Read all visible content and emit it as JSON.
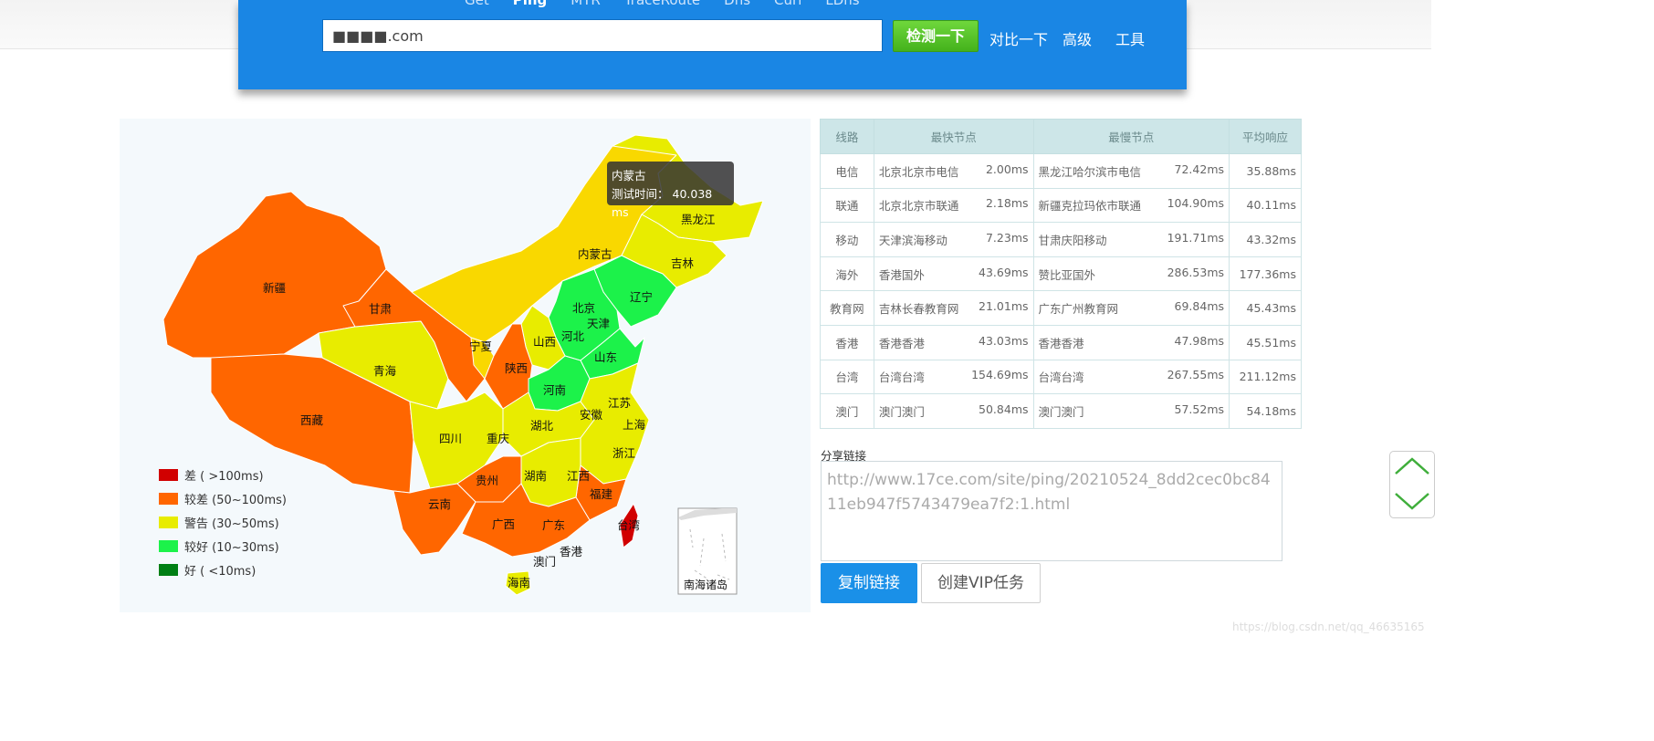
{
  "header": {
    "tabs": [
      "Get",
      "Ping",
      "MTR",
      "TraceRoute",
      "Dns",
      "Curl",
      "LDns"
    ],
    "active_tab": "Ping",
    "url_value": "■■■■.com",
    "check_button": "检测一下",
    "compare_link": "对比一下",
    "advanced_link": "高级",
    "tools_link": "工具",
    "colors": {
      "header_bg": "#1a86e4",
      "check_green": "#4cc21f"
    }
  },
  "map": {
    "tooltip": {
      "province": "内蒙古",
      "label": "测试时间：",
      "value": "40.038 ms"
    },
    "provinces": [
      "新疆",
      "西藏",
      "青海",
      "甘肃",
      "宁夏",
      "陕西",
      "山西",
      "北京",
      "天津",
      "河北",
      "辽宁",
      "吉林",
      "黑龙江",
      "内蒙古",
      "山东",
      "河南",
      "江苏",
      "上海",
      "安徽",
      "湖北",
      "四川",
      "重庆",
      "浙江",
      "贵州",
      "湖南",
      "江西",
      "福建",
      "云南",
      "广西",
      "广东",
      "台湾",
      "香港",
      "澳门",
      "海南"
    ],
    "inset_label": "南海诸岛",
    "legend": [
      {
        "label": "差 ( >100ms)",
        "color": "#d10000"
      },
      {
        "label": "较差 (50~100ms)",
        "color": "#ff6600"
      },
      {
        "label": "警告 (30~50ms)",
        "color": "#e8ec00"
      },
      {
        "label": "较好 (10~30ms)",
        "color": "#1cf24a"
      },
      {
        "label": "好 ( <10ms)",
        "color": "#007f14"
      }
    ]
  },
  "table": {
    "headers": [
      "线路",
      "最快节点",
      "最慢节点",
      "平均响应"
    ],
    "rows": [
      {
        "line": "电信",
        "fast_node": "北京北京市电信",
        "fast_ms": "2.00ms",
        "slow_node": "黑龙江哈尔滨市电信",
        "slow_ms": "72.42ms",
        "avg": "35.88ms"
      },
      {
        "line": "联通",
        "fast_node": "北京北京市联通",
        "fast_ms": "2.18ms",
        "slow_node": "新疆克拉玛依市联通",
        "slow_ms": "104.90ms",
        "avg": "40.11ms"
      },
      {
        "line": "移动",
        "fast_node": "天津滨海移动",
        "fast_ms": "7.23ms",
        "slow_node": "甘肃庆阳移动",
        "slow_ms": "191.71ms",
        "avg": "43.32ms"
      },
      {
        "line": "海外",
        "fast_node": "香港国外",
        "fast_ms": "43.69ms",
        "slow_node": "赞比亚国外",
        "slow_ms": "286.53ms",
        "avg": "177.36ms"
      },
      {
        "line": "教育网",
        "fast_node": "吉林长春教育网",
        "fast_ms": "21.01ms",
        "slow_node": "广东广州教育网",
        "slow_ms": "69.84ms",
        "avg": "45.43ms"
      },
      {
        "line": "香港",
        "fast_node": "香港香港",
        "fast_ms": "43.03ms",
        "slow_node": "香港香港",
        "slow_ms": "47.98ms",
        "avg": "45.51ms"
      },
      {
        "line": "台湾",
        "fast_node": "台湾台湾",
        "fast_ms": "154.69ms",
        "slow_node": "台湾台湾",
        "slow_ms": "267.55ms",
        "avg": "211.12ms"
      },
      {
        "line": "澳门",
        "fast_node": "澳门澳门",
        "fast_ms": "50.84ms",
        "slow_node": "澳门澳门",
        "slow_ms": "57.52ms",
        "avg": "54.18ms"
      }
    ]
  },
  "share": {
    "label": "分享链接",
    "url": "http://www.17ce.com/site/ping/20210524_8dd2cec0bc8411eb947f5743479ea7f2:1.html",
    "copy_button": "复制链接",
    "vip_button": "创建VIP任务"
  },
  "scroll": {
    "up_icon": "chevron-up-icon",
    "down_icon": "chevron-down-icon"
  },
  "watermark": "https://blog.csdn.net/qq_46635165"
}
